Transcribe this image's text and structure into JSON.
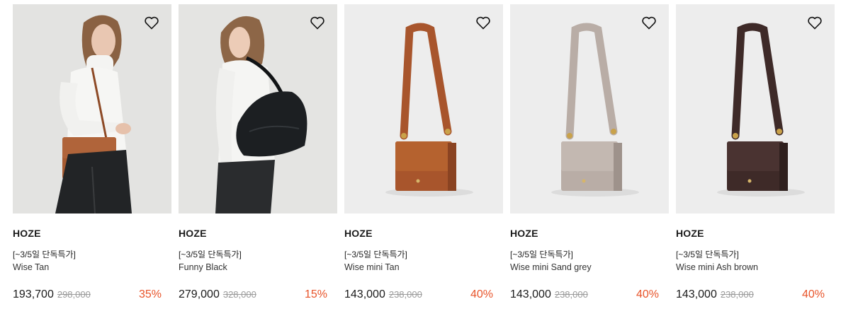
{
  "products": [
    {
      "brand": "HOZE",
      "promo": "[~3/5일 단독특가]",
      "name": "Wise Tan",
      "price": "193,700",
      "original_price": "298,000",
      "discount": "35%",
      "image": "model-with-tan-crossbody-bag",
      "bag_color": "#a65a30",
      "bg_color": "#e3e3e1",
      "wishlist_icon": "heart-outline-icon"
    },
    {
      "brand": "HOZE",
      "promo": "[~3/5일 단독특가]",
      "name": "Funny Black",
      "price": "279,000",
      "original_price": "328,000",
      "discount": "15%",
      "image": "model-with-black-shoulder-bag",
      "bag_color": "#1c1f22",
      "bg_color": "#e4e4e2",
      "wishlist_icon": "heart-outline-icon"
    },
    {
      "brand": "HOZE",
      "promo": "[~3/5일 단독특가]",
      "name": "Wise mini Tan",
      "price": "143,000",
      "original_price": "238,000",
      "discount": "40%",
      "image": "tan-mini-bag",
      "bag_color": "#a8552c",
      "bg_color": "#ededed",
      "wishlist_icon": "heart-outline-icon"
    },
    {
      "brand": "HOZE",
      "promo": "[~3/5일 단독특가]",
      "name": "Wise mini Sand grey",
      "price": "143,000",
      "original_price": "238,000",
      "discount": "40%",
      "image": "sand-grey-mini-bag",
      "bag_color": "#b9ada6",
      "bg_color": "#ededed",
      "wishlist_icon": "heart-outline-icon"
    },
    {
      "brand": "HOZE",
      "promo": "[~3/5일 단독특가]",
      "name": "Wise mini Ash brown",
      "price": "143,000",
      "original_price": "238,000",
      "discount": "40%",
      "image": "ash-brown-mini-bag",
      "bag_color": "#3e2a28",
      "bg_color": "#ededed",
      "wishlist_icon": "heart-outline-icon"
    }
  ],
  "colors": {
    "discount": "#e8542a",
    "original_price": "#9a9a9a",
    "text": "#1b1b1b"
  }
}
